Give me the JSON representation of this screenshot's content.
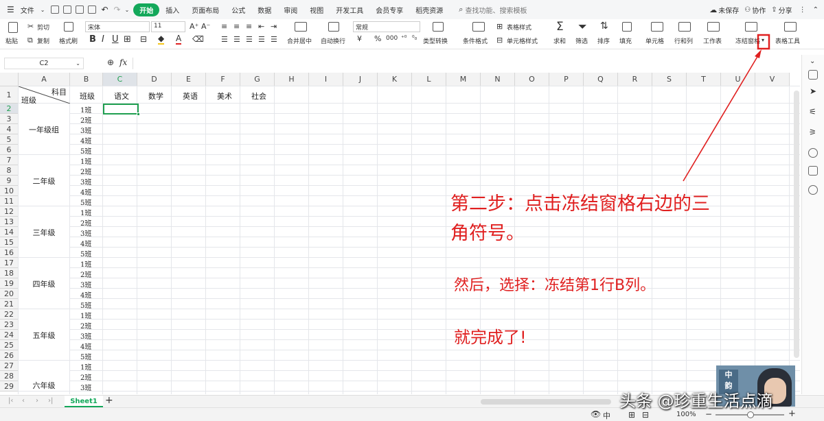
{
  "menu": {
    "file": "文件",
    "tabs": [
      "开始",
      "插入",
      "页面布局",
      "公式",
      "数据",
      "审阅",
      "视图",
      "开发工具",
      "会员专享",
      "稻壳资源"
    ],
    "search_placeholder": "查找功能、搜索模板",
    "unsaved": "未保存",
    "collab": "协作",
    "share": "分享"
  },
  "ribbon": {
    "paste": "粘贴",
    "cut": "剪切",
    "copy": "复制",
    "format_painter": "格式刷",
    "font_name": "宋体",
    "font_size": "11",
    "number_format": "常规",
    "merge_center": "合并居中",
    "wrap": "自动换行",
    "type_convert": "类型转换",
    "cond_format": "条件格式",
    "table_style": "表格样式",
    "cell_style": "单元格样式",
    "sum": "求和",
    "filter": "筛选",
    "sort": "排序",
    "fill": "填充",
    "cell": "单元格",
    "row_col": "行和列",
    "worksheet": "工作表",
    "freeze": "冻结窗格",
    "table_tools": "表格工具",
    "currency": "¥",
    "percent": "%"
  },
  "formula_bar": {
    "cell_ref": "C2",
    "fx": "fx"
  },
  "grid": {
    "columns": [
      "A",
      "B",
      "C",
      "D",
      "E",
      "F",
      "G",
      "H",
      "I",
      "J",
      "K",
      "L",
      "M",
      "N",
      "O",
      "P",
      "Q",
      "R",
      "S",
      "T",
      "U",
      "V"
    ],
    "rows": [
      "1",
      "2",
      "3",
      "4",
      "5",
      "6",
      "7",
      "8",
      "9",
      "10",
      "11",
      "12",
      "13",
      "14",
      "15",
      "16",
      "17",
      "18",
      "19",
      "20",
      "21",
      "22",
      "23",
      "24",
      "25",
      "26",
      "27",
      "28",
      "29"
    ],
    "a1_top": "科目",
    "a1_bottom": "班级",
    "header_row": [
      "班级",
      "语文",
      "数学",
      "英语",
      "美术",
      "社会"
    ],
    "groups": [
      "一年级组",
      "二年级",
      "三年级",
      "四年级",
      "五年级",
      "六年级"
    ],
    "classes": [
      "1班",
      "2班",
      "3班",
      "4班",
      "5班",
      "1班",
      "2班",
      "3班",
      "4班",
      "5班",
      "1班",
      "2班",
      "3班",
      "4班",
      "5班",
      "1班",
      "2班",
      "3班",
      "4班",
      "5班",
      "1班",
      "2班",
      "3班",
      "4班",
      "5班",
      "1班",
      "2班",
      "3班"
    ]
  },
  "sheet_tab": "Sheet1",
  "status": {
    "zoom": "100%",
    "mode": "中"
  },
  "annotation": {
    "step2_line1": "第二步：点击冻结窗格右边的三",
    "step2_line2": "角符号。",
    "then": "然后，选择：冻结第1行B列。",
    "done": "就完成了!",
    "watermark": "头条 @珍重生活点滴"
  },
  "colors": {
    "accent_green": "#13a85a",
    "annotation_red": "#e02020",
    "selection_green": "#1e9e4f"
  }
}
